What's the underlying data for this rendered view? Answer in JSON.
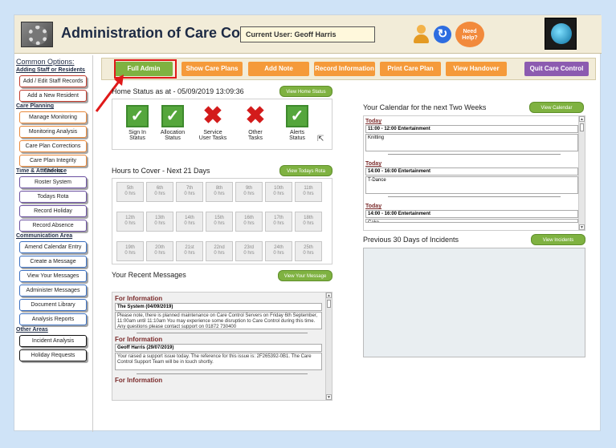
{
  "header": {
    "title": "Administration of Care Control",
    "current_user": "Current User: Geoff Harris",
    "help_label_1": "Need",
    "help_label_2": "Help?"
  },
  "sidebar": {
    "heading": "Common Options:",
    "sections": [
      {
        "title": "Adding Staff or Residents",
        "color": "#c0392b",
        "items": [
          "Add / Edit Staff Records",
          "Add a New Resident"
        ]
      },
      {
        "title": "Care Planning",
        "color": "#e8883a",
        "items": [
          "Manage Monitoring",
          "Monitoring Analysis",
          "Care Plan Corrections",
          "Care Plan Integrity Checks"
        ]
      },
      {
        "title": "Time & Attendence",
        "color": "#6a4fa0",
        "items": [
          "Roster System",
          "Todays Rota",
          "Record Holiday",
          "Record Absence"
        ]
      },
      {
        "title": "Communication Area",
        "color": "#3a6fc0",
        "items": [
          "Amend Calendar Entry",
          "Create a Message",
          "View Your Messages",
          "Administer Messages",
          "Document Library",
          "Analysis Reports"
        ]
      },
      {
        "title": "Other Areas",
        "color": "#111111",
        "items": [
          "Incident Analysis",
          "Holiday Requests"
        ]
      }
    ]
  },
  "nav": {
    "full_admin": "Full Admin",
    "show_care_plans": "Show Care Plans",
    "add_note": "Add Note",
    "record_information": "Record Information",
    "print_care_plan": "Print Care Plan",
    "view_handover": "View Handover",
    "quit": "Quit Care Control"
  },
  "home_status": {
    "title": "Home Status as at - 05/09/2019 13:09:36",
    "button": "View Home Status",
    "items": [
      {
        "label1": "Sign In",
        "label2": "Status",
        "ok": true
      },
      {
        "label1": "Allocation",
        "label2": "Status",
        "ok": true
      },
      {
        "label1": "Service",
        "label2": "User Tasks",
        "ok": false
      },
      {
        "label1": "Other",
        "label2": "Tasks",
        "ok": false
      },
      {
        "label1": "Alerts",
        "label2": "Status",
        "ok": true
      }
    ]
  },
  "hours": {
    "title": "Hours to Cover - Next 21 Days",
    "button": "View Todays Rota",
    "days": [
      {
        "day": "5th",
        "hrs": "0 hrs"
      },
      {
        "day": "6th",
        "hrs": "0 hrs"
      },
      {
        "day": "7th",
        "hrs": "0 hrs"
      },
      {
        "day": "8th",
        "hrs": "0 hrs"
      },
      {
        "day": "9th",
        "hrs": "0 hrs"
      },
      {
        "day": "10th",
        "hrs": "0 hrs"
      },
      {
        "day": "11th",
        "hrs": "0 hrs"
      },
      {
        "day": "12th",
        "hrs": "0 hrs"
      },
      {
        "day": "13th",
        "hrs": "0 hrs"
      },
      {
        "day": "14th",
        "hrs": "0 hrs"
      },
      {
        "day": "15th",
        "hrs": "0 hrs"
      },
      {
        "day": "16th",
        "hrs": "0 hrs"
      },
      {
        "day": "17th",
        "hrs": "0 hrs"
      },
      {
        "day": "18th",
        "hrs": "0 hrs"
      },
      {
        "day": "19th",
        "hrs": "0 hrs"
      },
      {
        "day": "20th",
        "hrs": "0 hrs"
      },
      {
        "day": "21st",
        "hrs": "0 hrs"
      },
      {
        "day": "22nd",
        "hrs": "0 hrs"
      },
      {
        "day": "23rd",
        "hrs": "0 hrs"
      },
      {
        "day": "24th",
        "hrs": "0 hrs"
      },
      {
        "day": "25th",
        "hrs": "0 hrs"
      }
    ]
  },
  "messages": {
    "title": "Your Recent Messages",
    "button": "View Your Message",
    "items": [
      {
        "heading": "For Information",
        "from": "The System (04/09/2019)",
        "body": "Please note, there is planned maintenance on Care Control Servers on Friday 6th September, 11:00am until 11:10am You may experience some disruption to Care Control during this time.  Any questions please contact support on 01872 730400"
      },
      {
        "heading": "For Information",
        "from": "Geoff Harris (29/07/2019)",
        "body": "Your raised a support issue today.  The reference for this issue is: 2F265392-0B1. The Care Control Support Team will be in touch shortly."
      },
      {
        "heading": "For Information",
        "from": "",
        "body": ""
      }
    ]
  },
  "calendar": {
    "title": "Your Calendar for the next Two Weeks",
    "button": "View Calendar",
    "entries": [
      {
        "date": "Today",
        "time": "11:00 - 12:00 Entertainment",
        "desc": "Knitting"
      },
      {
        "date": "Today",
        "time": "14:00 - 16:00 Entertainment",
        "desc": "T-Dance"
      },
      {
        "date": "Today",
        "time": "14:00 - 16:00 Entertainment",
        "desc": "Cake"
      }
    ]
  },
  "incidents": {
    "title": "Previous 30 Days of Incidents",
    "button": "View Incidents"
  },
  "colors": {
    "green": "#7fb241",
    "orange": "#f59a3a",
    "purple": "#8c5bb0",
    "highlight": "#e01919"
  },
  "icons": [
    "gear-icon",
    "user-icon",
    "refresh-icon",
    "globe-icon",
    "tick-icon",
    "cross-icon",
    "cursor-icon"
  ]
}
